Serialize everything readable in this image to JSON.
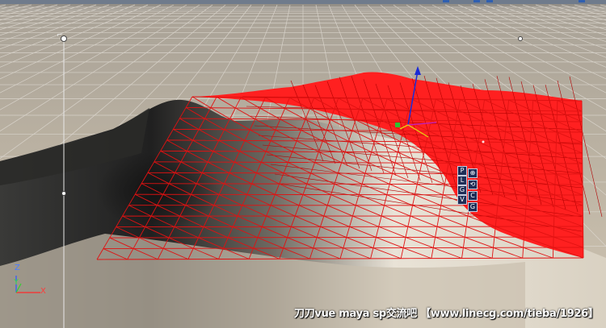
{
  "viewport": {
    "background_colors": {
      "sky": "#8a867e",
      "ground": "#bdb4a4",
      "grid_line": "#d8d4cc",
      "selected_mesh": "#ff1e1e",
      "terrain_light": "#e8e2d6",
      "terrain_dark": "#1c1c1a"
    }
  },
  "view_controls": {
    "buttons": [
      {
        "id": "p",
        "label": "P"
      },
      {
        "id": "move",
        "label": "⊕"
      },
      {
        "id": "l",
        "label": "L"
      },
      {
        "id": "rotate",
        "label": "⟲"
      },
      {
        "id": "g",
        "label": "G"
      },
      {
        "id": "c",
        "label": "C"
      },
      {
        "id": "v",
        "label": "V"
      },
      {
        "id": "s",
        "label": "G"
      }
    ]
  },
  "axis_indicator": {
    "z": "Z",
    "y": "Y",
    "x": "X"
  },
  "watermark": "刀刀vue maya sp交流吧 【www.linecg.com/tieba/1926】"
}
